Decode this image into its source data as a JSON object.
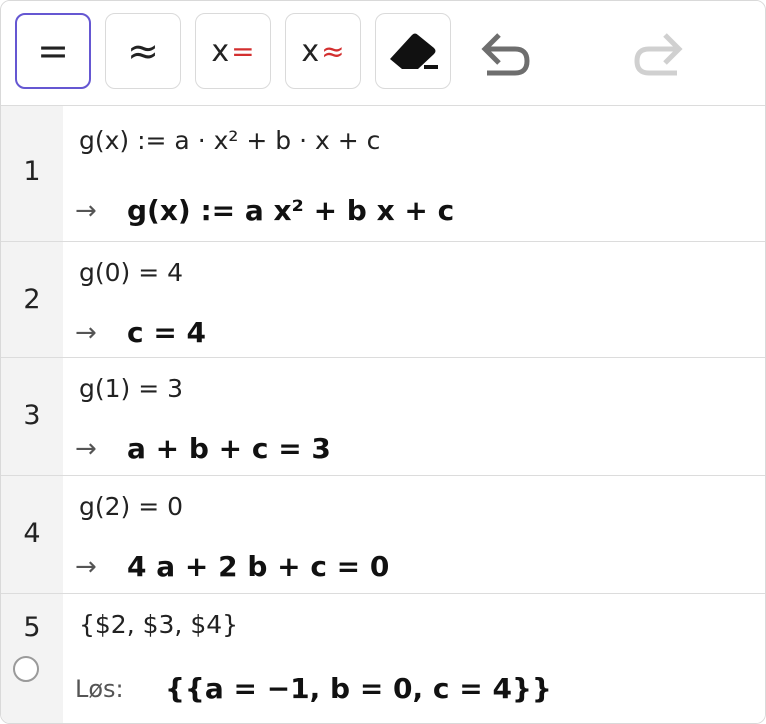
{
  "toolbar": {
    "exact_label": "=",
    "numeric_label": "≈",
    "solve_x": "x",
    "solve_eq": "=",
    "nsolve_x": "x",
    "nsolve_approx": "≈",
    "icons": [
      "eraser-icon",
      "undo-icon",
      "redo-icon"
    ]
  },
  "rows": [
    {
      "number": "1",
      "input": "g(x) := a · x² + b · x + c",
      "output": "g(x) := a x² + b x + c"
    },
    {
      "number": "2",
      "input": "g(0) = 4",
      "output": "c = 4"
    },
    {
      "number": "3",
      "input": "g(1) = 3",
      "output": "a + b + c = 3"
    },
    {
      "number": "4",
      "input": "g(2) = 0",
      "output": "4 a + 2 b + c = 0"
    },
    {
      "number": "5",
      "input": "{$2, $3, $4}",
      "command": "Løs:",
      "output": "{{a = −1, b = 0, c = 4}}"
    }
  ],
  "output_arrow": "→"
}
